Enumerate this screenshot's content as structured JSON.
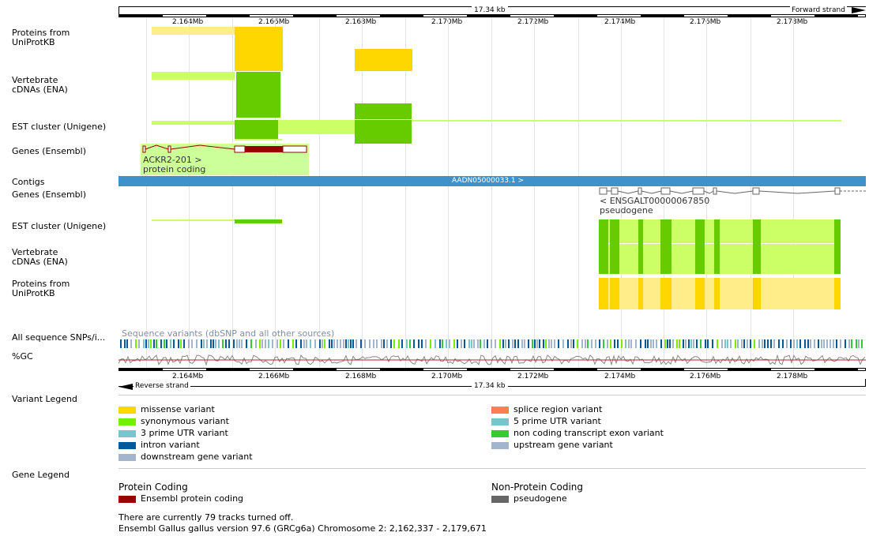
{
  "scale": {
    "span_label": "17.34 kb",
    "forward_strand": "Forward strand",
    "reverse_strand": "Reverse strand",
    "ticks": [
      "2.164Mb",
      "2.166Mb",
      "2.168Mb",
      "2.170Mb",
      "2.172Mb",
      "2.174Mb",
      "2.176Mb",
      "2.178Mb"
    ]
  },
  "tracks": {
    "proteins_top": "Proteins from\nUniProtKB",
    "vertebrate_top": "Vertebrate\ncDNAs (ENA)",
    "est_top": "EST cluster (Unigene)",
    "genes_top": "Genes (Ensembl)",
    "contigs": "Contigs",
    "genes_bottom": "Genes (Ensembl)",
    "est_bottom": "EST cluster (Unigene)",
    "vertebrate_bottom": "Vertebrate\ncDNAs (ENA)",
    "proteins_bottom": "Proteins from\nUniProtKB",
    "snps": "All sequence SNPs/i...",
    "gc": "%GC"
  },
  "features": {
    "gene_forward_name": "ACKR2-201 >",
    "gene_forward_type": "protein coding",
    "contig_name": "AADN05000033.1 >",
    "gene_reverse_name": "< ENSGALT00000067850",
    "gene_reverse_type": "pseudogene",
    "snp_track_note": "Sequence variants (dbSNP and all other sources)"
  },
  "variant_legend": {
    "title": "Variant Legend",
    "items": [
      {
        "label": "missense variant",
        "color": "#ffd700"
      },
      {
        "label": "synonymous variant",
        "color": "#76ee00"
      },
      {
        "label": "3 prime UTR variant",
        "color": "#7ac5cd"
      },
      {
        "label": "intron variant",
        "color": "#02599c"
      },
      {
        "label": "downstream gene variant",
        "color": "#a2b5cd"
      },
      {
        "label": "splice region variant",
        "color": "#ff7f50"
      },
      {
        "label": "5 prime UTR variant",
        "color": "#7ac5cd"
      },
      {
        "label": "non coding transcript exon variant",
        "color": "#32cd32"
      },
      {
        "label": "upstream gene variant",
        "color": "#a2b5cd"
      }
    ]
  },
  "gene_legend": {
    "title": "Gene Legend",
    "protein_coding_title": "Protein Coding",
    "protein_coding_item": "Ensembl protein coding",
    "protein_coding_color": "#9a0000",
    "non_protein_coding_title": "Non-Protein Coding",
    "non_protein_coding_item": "pseudogene",
    "non_protein_coding_color": "#666666"
  },
  "footer": {
    "tracks_off": "There are currently 79 tracks turned off.",
    "version": "Ensembl Gallus gallus version 97.6 (GRCg6a) Chromosome 2: 2,162,337 - 2,179,671"
  },
  "colors": {
    "protein_yellow": "#ffd700",
    "protein_pale": "#ffed8a",
    "cdna_green": "#66cc00",
    "est_pale": "#ccff66",
    "contig_blue": "#3e92c9",
    "gene_bg": "#ccff99",
    "coding_red": "#9a0000"
  }
}
